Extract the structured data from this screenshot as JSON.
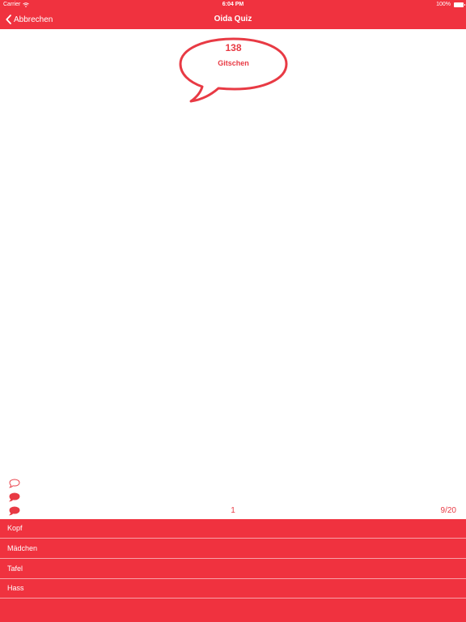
{
  "status_bar": {
    "carrier": "Carrier",
    "time": "6:04 PM",
    "battery": "100%",
    "icons": [
      "wifi-icon",
      "battery-icon"
    ]
  },
  "nav": {
    "back_label": "Abbrechen",
    "title": "Oida Quiz",
    "back_icon": "chevron-left-icon"
  },
  "question": {
    "number": "138",
    "word": "Gitschen"
  },
  "lives": {
    "icons": [
      "speech-bubble-outline-icon",
      "speech-bubble-filled-icon",
      "speech-bubble-filled-icon"
    ]
  },
  "footer": {
    "score": "1",
    "progress": "9/20"
  },
  "answers": [
    {
      "label": "Kopf"
    },
    {
      "label": "Mädchen"
    },
    {
      "label": "Tafel"
    },
    {
      "label": "Hass"
    }
  ],
  "colors": {
    "accent": "#f0323f",
    "text_accent": "#e83a44",
    "background": "#ffffff"
  }
}
